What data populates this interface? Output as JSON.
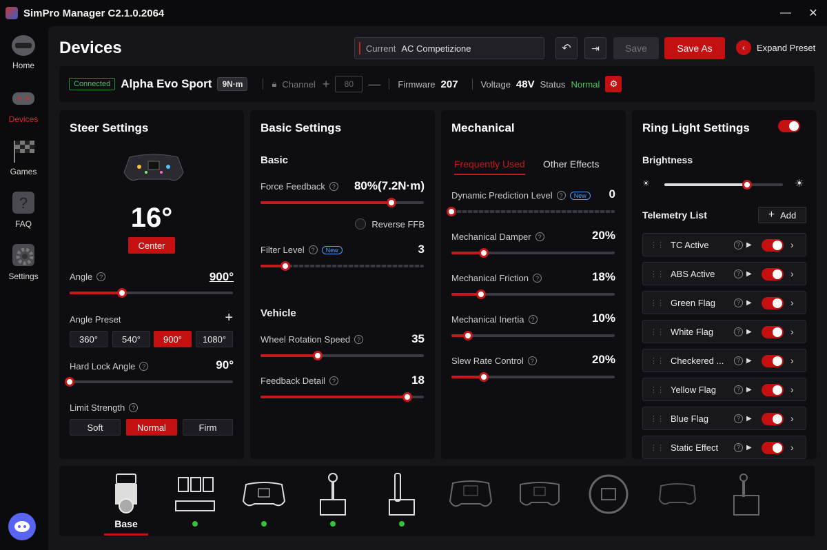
{
  "app": {
    "title": "SimPro Manager C2.1.0.2064"
  },
  "sidebar": {
    "items": [
      {
        "label": "Home",
        "icon": "helmet-icon"
      },
      {
        "label": "Devices",
        "icon": "steering-wheel-icon"
      },
      {
        "label": "Games",
        "icon": "checkered-flag-icon"
      },
      {
        "label": "FAQ",
        "icon": "question-icon"
      },
      {
        "label": "Settings",
        "icon": "gear-icon"
      }
    ],
    "active": "Devices"
  },
  "header": {
    "page_title": "Devices",
    "preset_label": "Current",
    "preset_value": "AC Competizione",
    "save": "Save",
    "save_as": "Save As",
    "expand": "Expand Preset"
  },
  "device_bar": {
    "status": "Connected",
    "name": "Alpha Evo Sport",
    "torque": "9N·m",
    "channel_label": "Channel",
    "channel_value": "80",
    "firmware_label": "Firmware",
    "firmware_value": "207",
    "voltage_label": "Voltage",
    "voltage_value": "48V",
    "status_label": "Status",
    "status_value": "Normal"
  },
  "steer": {
    "title": "Steer Settings",
    "angle_display": "16°",
    "center": "Center",
    "angle_label": "Angle",
    "angle_value": "900°",
    "angle_level": 0.32,
    "preset_label": "Angle Preset",
    "presets": [
      "360°",
      "540°",
      "900°",
      "1080°"
    ],
    "preset_selected": "900°",
    "hardlock_label": "Hard Lock Angle",
    "hardlock_value": "90°",
    "hardlock_level": 0.0,
    "limit_label": "Limit Strength",
    "limits": [
      "Soft",
      "Normal",
      "Firm"
    ],
    "limit_selected": "Normal"
  },
  "basic": {
    "title": "Basic Settings",
    "basic_head": "Basic",
    "ffb_label": "Force Feedback",
    "ffb_value": "80%(7.2N·m)",
    "ffb_level": 0.8,
    "reverse_label": "Reverse FFB",
    "filter_label": "Filter Level",
    "filter_value": "3",
    "filter_level": 0.15,
    "vehicle_head": "Vehicle",
    "wheel_label": "Wheel Rotation Speed",
    "wheel_value": "35",
    "wheel_level": 0.35,
    "detail_label": "Feedback Detail",
    "detail_value": "18",
    "detail_level": 0.9,
    "new_tag": "New"
  },
  "mech": {
    "title": "Mechanical",
    "tab_active": "Frequently Used",
    "tab_other": "Other Effects",
    "rows": [
      {
        "label": "Dynamic Prediction Level",
        "value": "0",
        "level": 0.0,
        "new": true
      },
      {
        "label": "Mechanical Damper",
        "value": "20%",
        "level": 0.2
      },
      {
        "label": "Mechanical Friction",
        "value": "18%",
        "level": 0.18
      },
      {
        "label": "Mechanical Inertia",
        "value": "10%",
        "level": 0.1
      },
      {
        "label": "Slew Rate Control",
        "value": "20%",
        "level": 0.2
      }
    ]
  },
  "ring": {
    "title": "Ring Light Settings",
    "brightness_label": "Brightness",
    "brightness_level": 0.7,
    "telemetry_label": "Telemetry List",
    "add": "Add",
    "items": [
      "TC Active",
      "ABS Active",
      "Green Flag",
      "White Flag",
      "Checkered ...",
      "Yellow Flag",
      "Blue Flag",
      "Static Effect"
    ]
  },
  "bottom": {
    "devices": [
      {
        "name": "base-device",
        "label": "Base",
        "active": true,
        "connected": false
      },
      {
        "name": "pedals-device",
        "connected": true
      },
      {
        "name": "wheel-formula-device",
        "connected": true
      },
      {
        "name": "shifter-device",
        "connected": true
      },
      {
        "name": "handbrake-device",
        "connected": true
      },
      {
        "name": "wheel-f1-device",
        "connected": false
      },
      {
        "name": "wheel-gt-device",
        "connected": false
      },
      {
        "name": "wheel-round-device",
        "connected": false
      },
      {
        "name": "wheel-small-device",
        "connected": false
      },
      {
        "name": "shifter-box-device",
        "connected": false
      }
    ]
  },
  "colors": {
    "accent": "#c41010",
    "connected": "#4fc35d",
    "panel": "#0e0e12"
  }
}
